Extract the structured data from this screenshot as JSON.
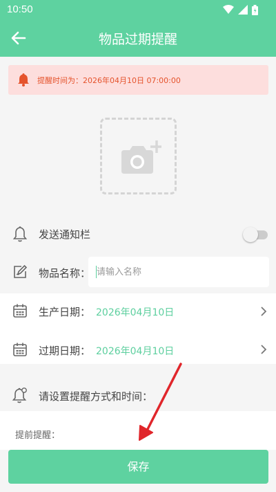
{
  "status_bar": {
    "time": "10:50"
  },
  "header": {
    "title": "物品过期提醒"
  },
  "alert": {
    "text": "提醒时间为：2026年04月10日 07:00:00"
  },
  "notify_row": {
    "label": "发送通知栏",
    "toggle_on": false
  },
  "name_row": {
    "label": "物品名称：",
    "placeholder": "请输入名称"
  },
  "production_row": {
    "label": "生产日期：",
    "value": "2026年04月10日"
  },
  "expiry_row": {
    "label": "过期日期：",
    "value": "2026年04月10日"
  },
  "reminder_section": {
    "label": "请设置提醒方式和时间："
  },
  "advance_section": {
    "label": "提前提醒："
  },
  "save_button": {
    "label": "保存"
  },
  "colors": {
    "accent": "#5ed2a0",
    "value_text": "#5ccf9e",
    "alert_bg": "#fddedd",
    "alert_text": "#e5532c",
    "annotation_arrow": "#e0262b"
  },
  "icons": [
    "back-arrow-icon",
    "bell-alert-icon",
    "camera-add-icon",
    "bell-icon",
    "edit-icon",
    "calendar-icon",
    "bell-settings-icon",
    "chevron-right-icon"
  ]
}
